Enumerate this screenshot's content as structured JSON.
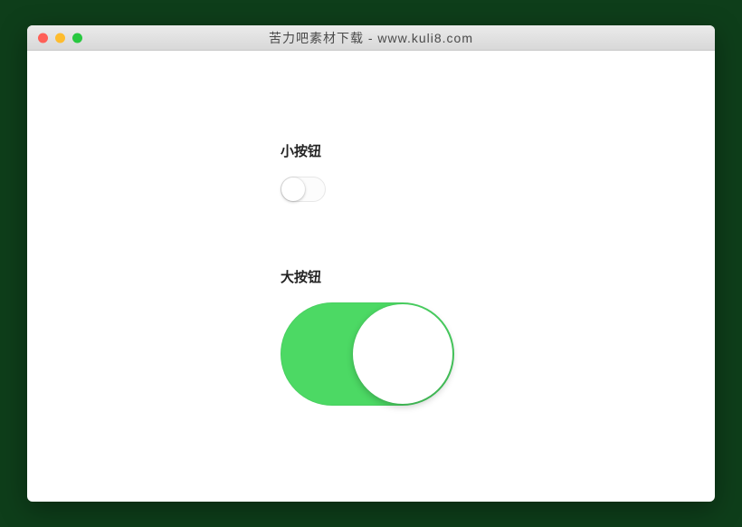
{
  "window": {
    "title": "苦力吧素材下载 - www.kuli8.com",
    "traffic": {
      "red": "#ff5f57",
      "yellow": "#febc2e",
      "green": "#28c840"
    }
  },
  "toggles": {
    "small": {
      "label": "小按钮",
      "state": "off"
    },
    "large": {
      "label": "大按钮",
      "state": "on",
      "on_color": "#4cd964"
    }
  }
}
